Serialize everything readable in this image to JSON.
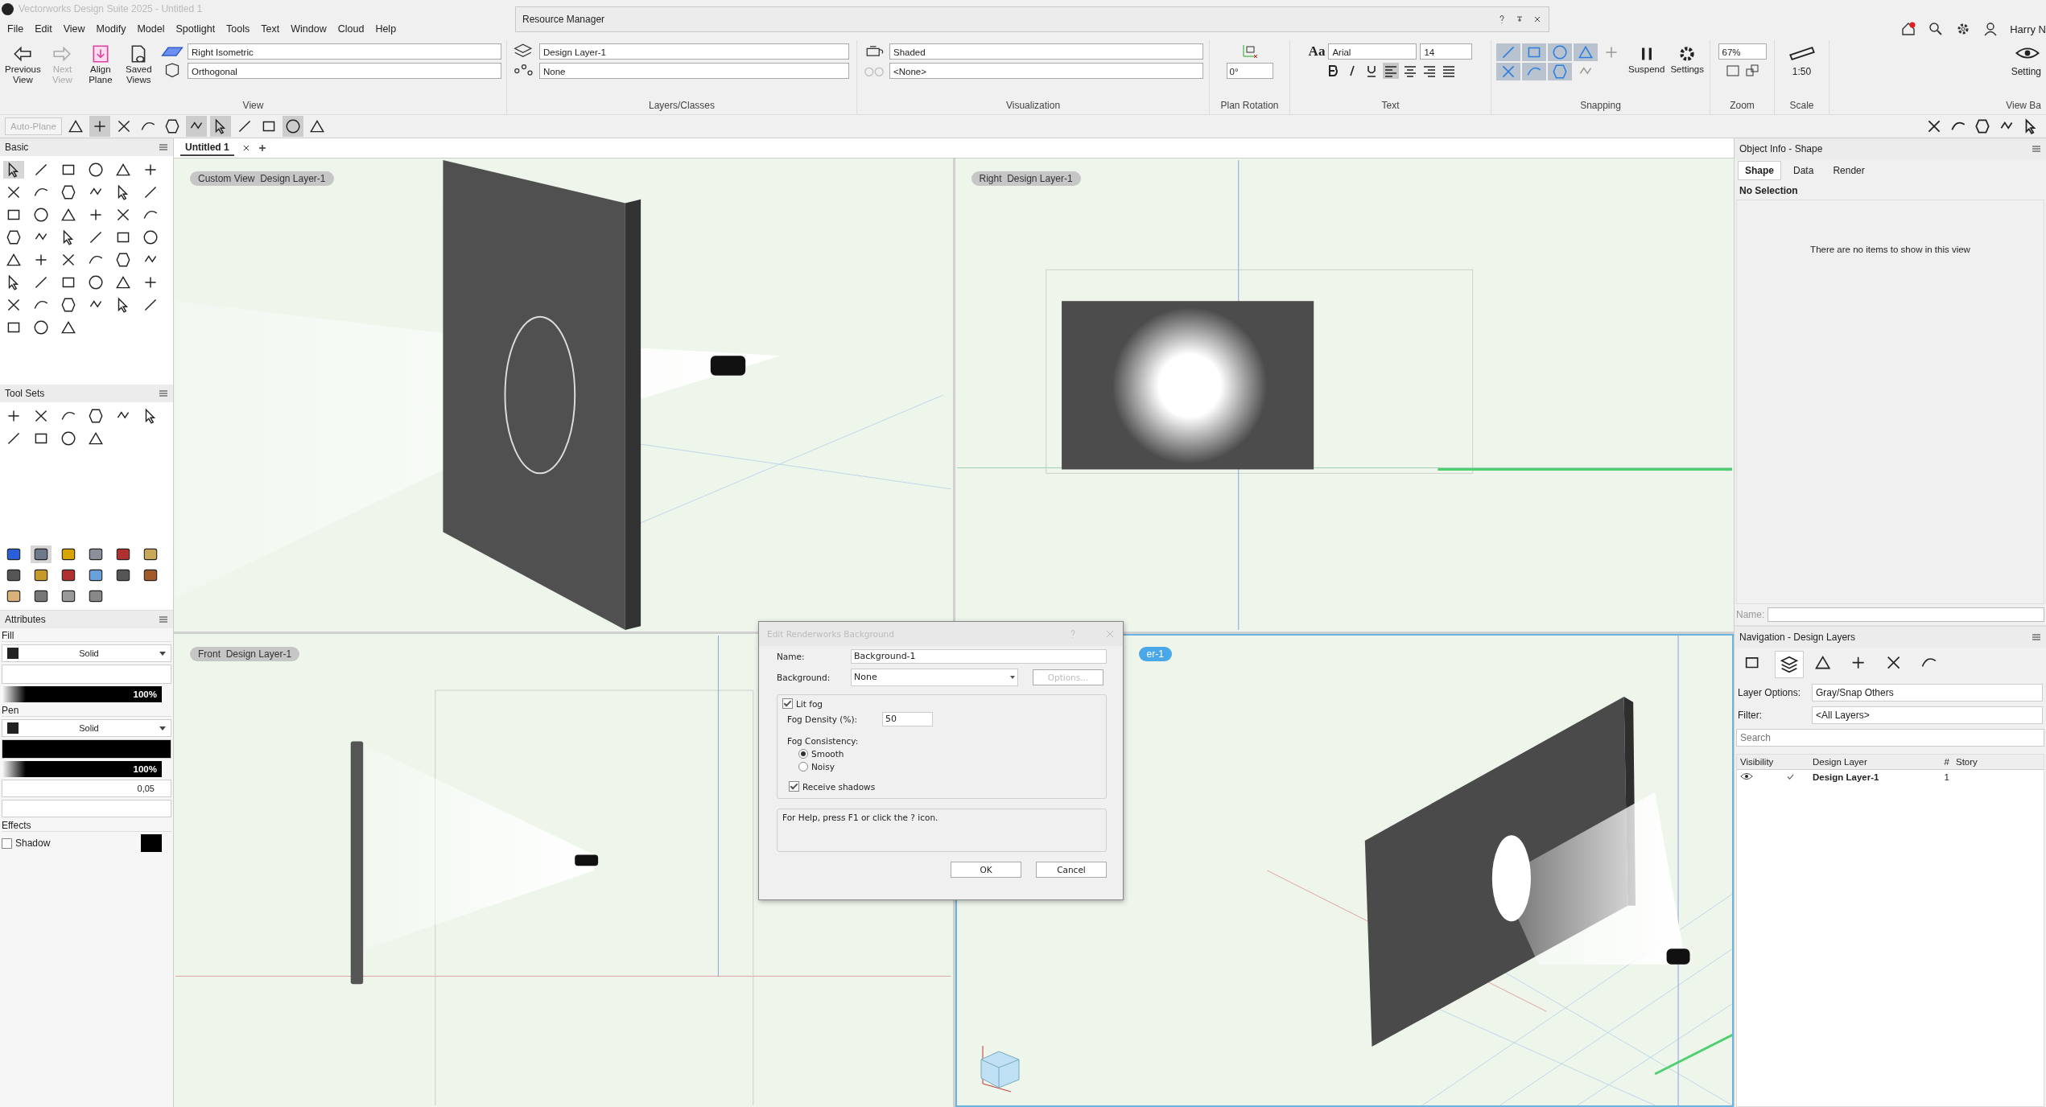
{
  "app_title": "Vectorworks Design Suite 2025 - Untitled 1",
  "menu": [
    "File",
    "Edit",
    "View",
    "Modify",
    "Model",
    "Spotlight",
    "Tools",
    "Text",
    "Window",
    "Cloud",
    "Help"
  ],
  "resource_manager": {
    "title": "Resource Manager"
  },
  "user": "Harry N",
  "ribbon": {
    "view": {
      "label": "View",
      "buttons": [
        {
          "label": "Previous View",
          "disabled": false
        },
        {
          "label": "Next View",
          "disabled": true
        },
        {
          "label": "Align Plane",
          "disabled": false
        },
        {
          "label": "Saved Views",
          "disabled": false
        }
      ],
      "view_select": "Right Isometric",
      "projection": "Orthogonal"
    },
    "layers": {
      "label": "Layers/Classes",
      "layer": "Design Layer-1",
      "class": "None"
    },
    "visualization": {
      "label": "Visualization",
      "render": "Shaded",
      "lighting": "<None>"
    },
    "plan_rotation": {
      "label": "Plan Rotation",
      "value": "0°"
    },
    "text": {
      "label": "Text",
      "style_glyph": "Aa",
      "font": "Arial",
      "size": "14",
      "alignments": [
        {
          "selected": true
        },
        {
          "selected": false
        },
        {
          "selected": false
        },
        {
          "selected": false
        }
      ]
    },
    "snapping": {
      "label": "Snapping",
      "modes": [
        {
          "on": true
        },
        {
          "on": true
        },
        {
          "on": true
        },
        {
          "on": true
        },
        {
          "on": false
        },
        {
          "on": true
        },
        {
          "on": true
        },
        {
          "on": true
        },
        {
          "on": false
        }
      ],
      "suspend": "Suspend",
      "settings": "Settings"
    },
    "zoom": {
      "label": "Zoom",
      "value": "67%"
    },
    "scale": {
      "label": "Scale",
      "value": "1:50"
    },
    "view_bar": {
      "label": "View Ba",
      "settings": "Setting"
    }
  },
  "mode_bar": {
    "auto_plane": "Auto-Plane"
  },
  "palettes": {
    "basic": "Basic",
    "tool_sets": "Tool Sets",
    "attributes": {
      "title": "Attributes",
      "fill": "Fill",
      "fill_style": "Solid",
      "fill_opacity": "100%",
      "pen": "Pen",
      "pen_style": "Solid",
      "pen_opacity": "100%",
      "line_weight": "0,05",
      "effects": "Effects",
      "shadow": {
        "label": "Shadow",
        "checked": false
      }
    }
  },
  "document_tabs": [
    {
      "label": "Untitled 1",
      "selected": true
    }
  ],
  "viewports": [
    {
      "kind": "custom",
      "tag": "Custom View  Design Layer-1",
      "active": false
    },
    {
      "kind": "right",
      "tag": "Right  Design Layer-1",
      "active": false
    },
    {
      "kind": "front",
      "tag": "Front  Design Layer-1",
      "active": false
    },
    {
      "kind": "iso",
      "tag": "er-1",
      "active": true
    }
  ],
  "dialog": {
    "title": "Edit Renderworks Background",
    "name_label": "Name:",
    "name": "Background-1",
    "background_label": "Background:",
    "background": "None",
    "options": "Options...",
    "options_disabled": true,
    "lit_fog": {
      "label": "Lit fog",
      "checked": true
    },
    "density_label": "Fog Density (%):",
    "density": "50",
    "consistency_label": "Fog Consistency:",
    "radios": [
      {
        "label": "Smooth",
        "selected": true
      },
      {
        "label": "Noisy",
        "selected": false
      }
    ],
    "receive_shadows": {
      "label": "Receive shadows",
      "checked": true
    },
    "help": "For Help, press F1 or click the ? icon.",
    "ok": "OK",
    "cancel": "Cancel"
  },
  "object_info": {
    "title": "Object Info - Shape",
    "tabs": [
      {
        "label": "Shape",
        "selected": true
      },
      {
        "label": "Data",
        "selected": false
      },
      {
        "label": "Render",
        "selected": false
      }
    ],
    "selection": "No Selection",
    "empty": "There are no items to show in this view",
    "name_label": "Name:"
  },
  "navigation": {
    "title": "Navigation - Design Layers",
    "tabs": [
      {
        "selected": false
      },
      {
        "selected": true
      },
      {
        "selected": false
      },
      {
        "selected": false
      },
      {
        "selected": false
      },
      {
        "selected": false
      }
    ],
    "layer_options_label": "Layer Options:",
    "layer_options": "Gray/Snap Others",
    "filter_label": "Filter:",
    "filter": "<All Layers>",
    "search_placeholder": "Search",
    "columns": [
      "Visibility",
      "Design Layer",
      "#",
      "Story"
    ],
    "rows": [
      {
        "name": "Design Layer-1",
        "number": "1",
        "visible": true,
        "active": true
      }
    ]
  }
}
